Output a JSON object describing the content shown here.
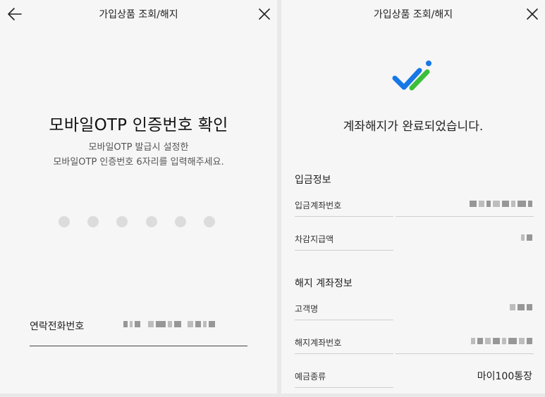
{
  "left": {
    "header": {
      "title": "가입상품 조회/해지",
      "back_icon": "arrow-left-icon",
      "close_icon": "close-icon"
    },
    "title": "모바일OTP 인증번호 확인",
    "desc_line1": "모바일OTP 발급시 설정한",
    "desc_line2": "모바일OTP 인증번호 6자리를 입력해주세요.",
    "pin_dots": 6,
    "pin_entered": 0,
    "phone": {
      "label": "연락전화번호"
    }
  },
  "right": {
    "header": {
      "title": "가입상품 조회/해지",
      "close_icon": "close-icon"
    },
    "success_icon": "double-check-icon",
    "message": "계좌해지가 완료되었습니다.",
    "deposit": {
      "title": "입금정보",
      "account_label": "입금계좌번호",
      "amount_label": "차감지급액"
    },
    "closing": {
      "title": "해지 계좌정보",
      "customer_label": "고객명",
      "account_label": "해지계좌번호",
      "type_label": "예금종류",
      "type_value": "마이100통장"
    }
  },
  "colors": {
    "check_blue": "#1677e6",
    "check_green": "#3bbf3a",
    "background": "#f6f6f6"
  }
}
